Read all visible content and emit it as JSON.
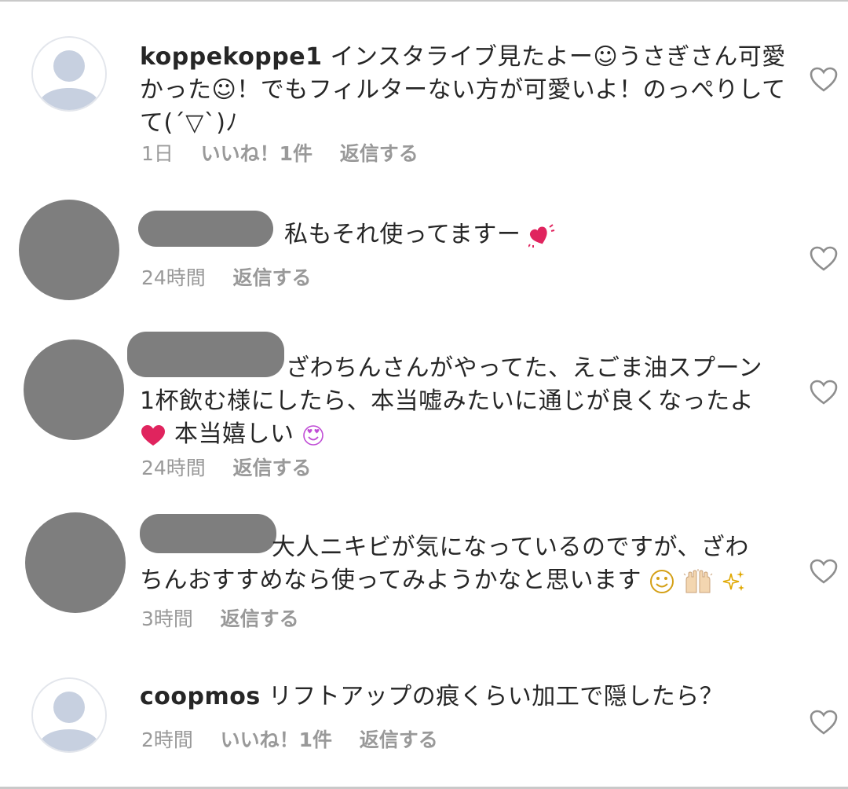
{
  "comments": [
    {
      "username": "koppekoppe1",
      "text": "インスタライブ見たよー☺うさぎさん可愛かった☺！でもフィルターない方が可愛いよ！のっぺりしてて(´▽`)ﾉ",
      "time": "1日",
      "likes": "いいね！1件",
      "reply": "返信する"
    },
    {
      "username": "",
      "text": "私もそれ使ってますー",
      "emoji_after": "heart-with-sparkle-icon",
      "time": "24時間",
      "reply": "返信する"
    },
    {
      "username": "",
      "text_line1": "ざわちんさんがやってた、えごま油スプーン",
      "text_line2": "1杯飲む様にしたら、本当嘘みたいに通じが良くなったよ",
      "text_line3": "本当嬉しい",
      "emoji_start": "red-heart-icon",
      "emoji_end": "heart-eyes-face-icon",
      "time": "24時間",
      "reply": "返信する"
    },
    {
      "username": "",
      "text_line1": "大人ニキビが気になっているのですが、ざわ",
      "text_line2": "ちんおすすめなら使ってみようかなと思います",
      "emojis": [
        "smiley-face-icon",
        "raised-hands-icon",
        "sparkles-icon"
      ],
      "time": "3時間",
      "reply": "返信する"
    },
    {
      "username": "coopmos",
      "text": "リフトアップの痕くらい加工で隠したら？",
      "time": "2時間",
      "likes": "いいね！1件",
      "reply": "返信する"
    }
  ],
  "colors": {
    "text": "#262626",
    "meta": "#999999",
    "mask": "#7e7e7e",
    "avatar_placeholder": "#c7d0e0",
    "heart_outline": "#8e8e8e",
    "red_heart": "#e0245e"
  }
}
